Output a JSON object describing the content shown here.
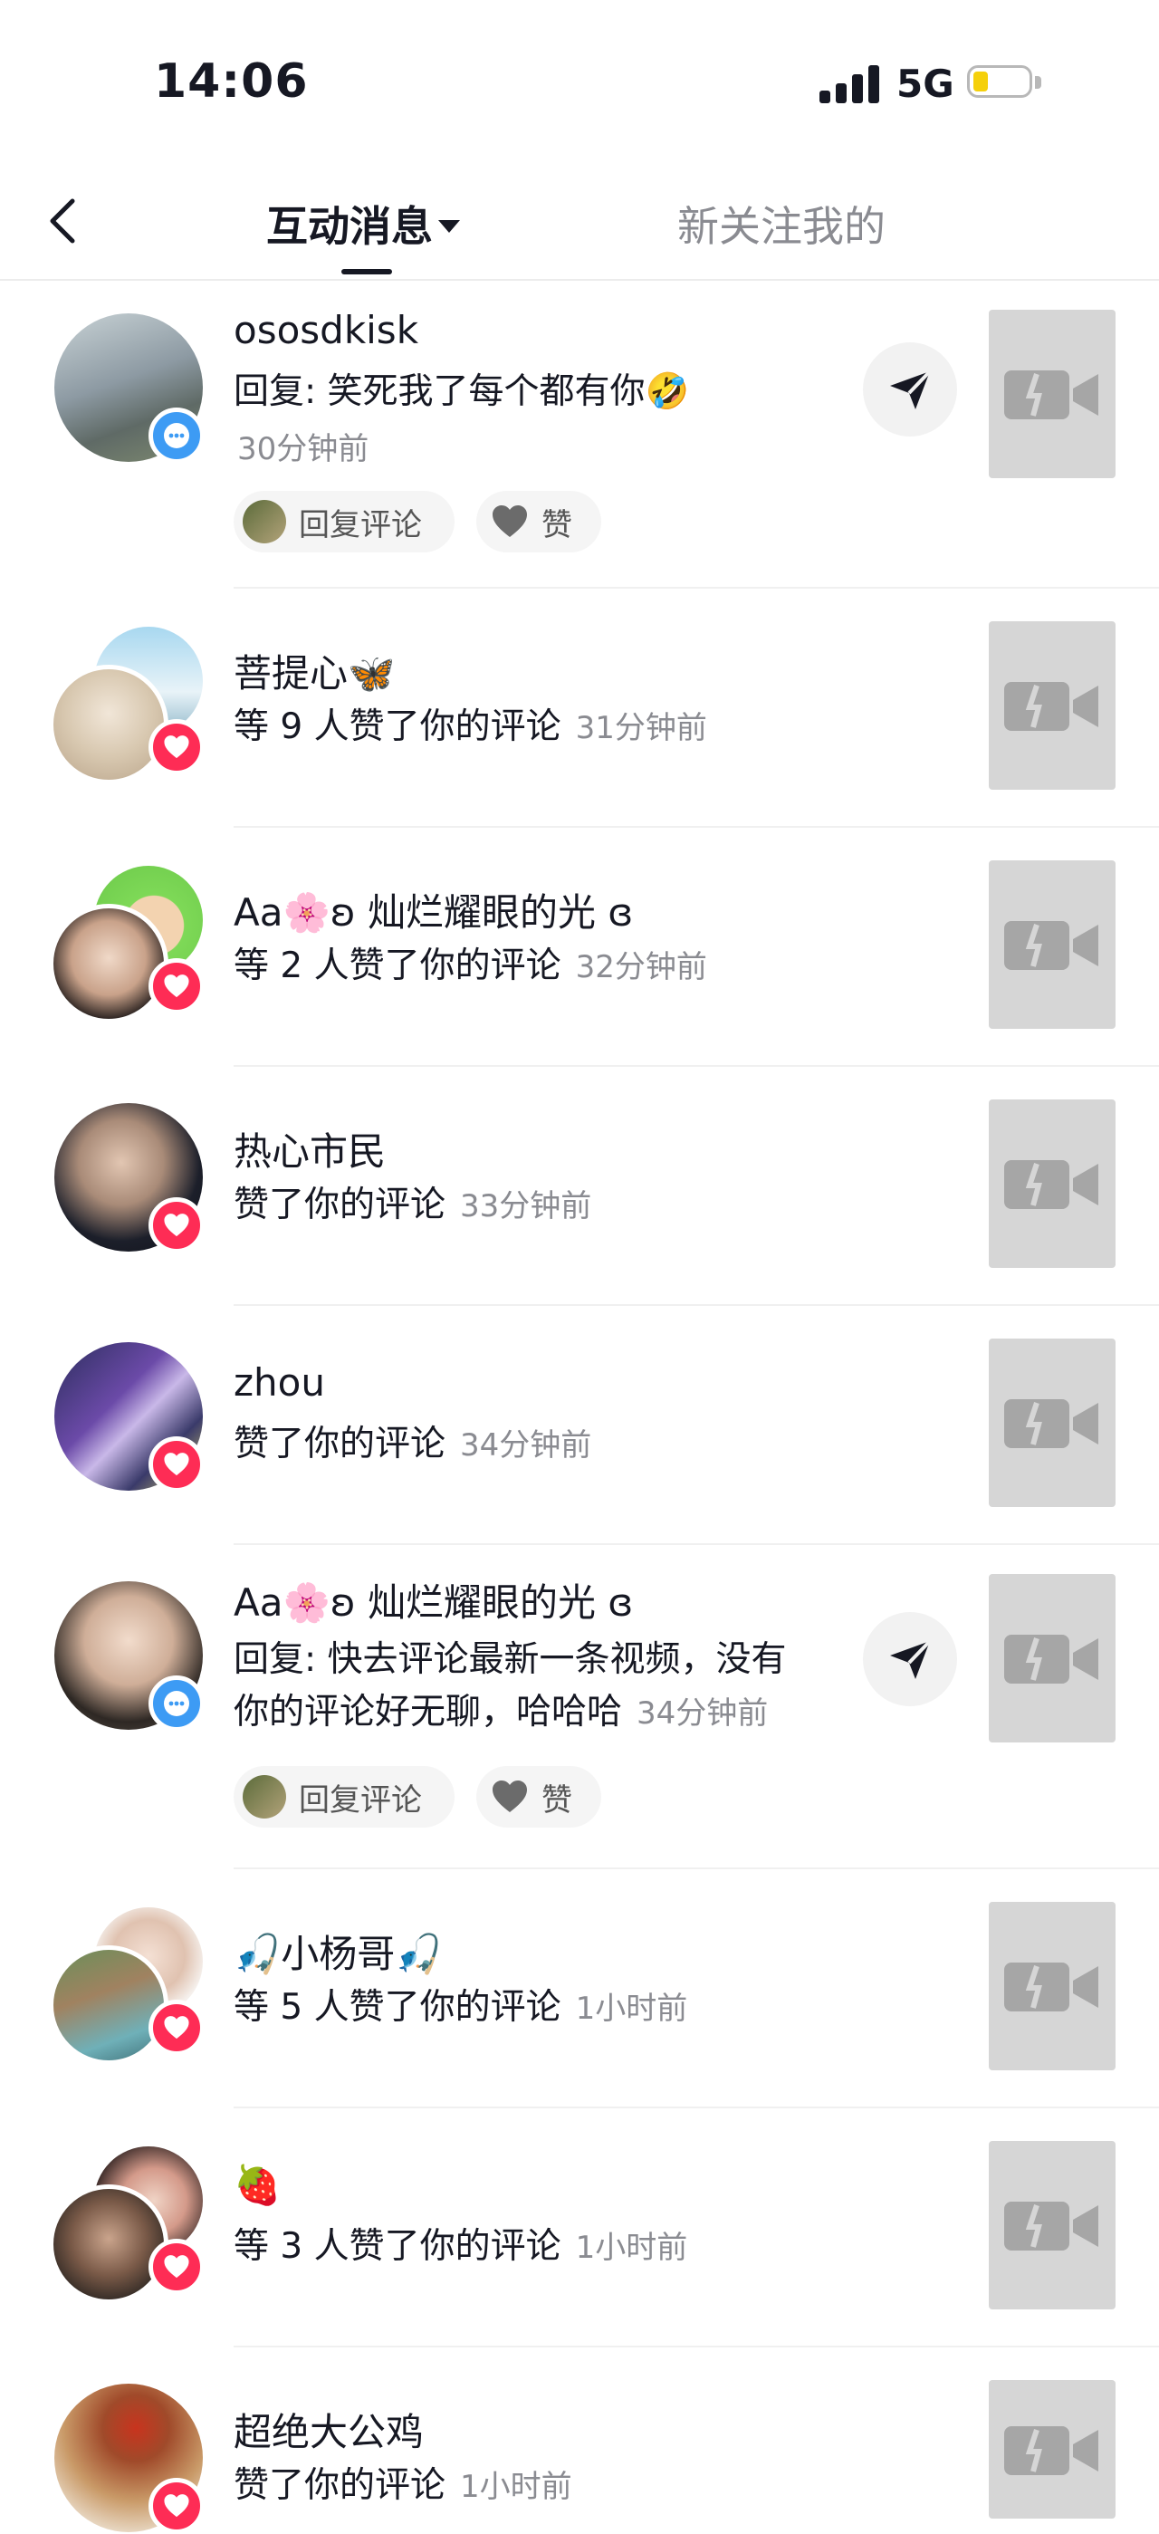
{
  "status_bar": {
    "time": "14:06",
    "network": "5G"
  },
  "header": {
    "back_icon": "chevron-left-icon",
    "tabs": [
      {
        "label": "互动消息",
        "active": true
      },
      {
        "label": "新关注我的",
        "active": false
      }
    ]
  },
  "colors": {
    "heart_badge": "#fe2c55",
    "comment_badge": "#3d9bf4",
    "secondary_text": "#8a8b91",
    "placeholder": "#d6d6d6"
  },
  "notifications": [
    {
      "name": "ososdkisk",
      "text": "回复: 笑死我了每个都有你🤣",
      "time": "30分钟前",
      "type": "reply",
      "reply_label": "回复评论",
      "like_label": "赞"
    },
    {
      "name": "菩提心🦋",
      "text": "等 9 人赞了你的评论",
      "time": "31分钟前",
      "type": "like"
    },
    {
      "name": "Aa🌸ʚ 灿烂耀眼的光 ɞ",
      "text": "等 2 人赞了你的评论",
      "time": "32分钟前",
      "type": "like"
    },
    {
      "name": "热心市民",
      "text": "赞了你的评论",
      "time": "33分钟前",
      "type": "like"
    },
    {
      "name": "zhou",
      "text": "赞了你的评论",
      "time": "34分钟前",
      "type": "like"
    },
    {
      "name": "Aa🌸ʚ 灿烂耀眼的光 ɞ",
      "text_line1": "回复: 快去评论最新一条视频，没有",
      "text_line2": "你的评论好无聊，哈哈哈",
      "time": "34分钟前",
      "type": "reply",
      "reply_label": "回复评论",
      "like_label": "赞"
    },
    {
      "name": "🎣小杨哥🎣",
      "text": "等 5 人赞了你的评论",
      "time": "1小时前",
      "type": "like"
    },
    {
      "name": "🍓",
      "text": "等 3 人赞了你的评论",
      "time": "1小时前",
      "type": "like"
    },
    {
      "name": "超绝大公鸡",
      "text": "赞了你的评论",
      "time": "1小时前",
      "type": "like"
    }
  ]
}
